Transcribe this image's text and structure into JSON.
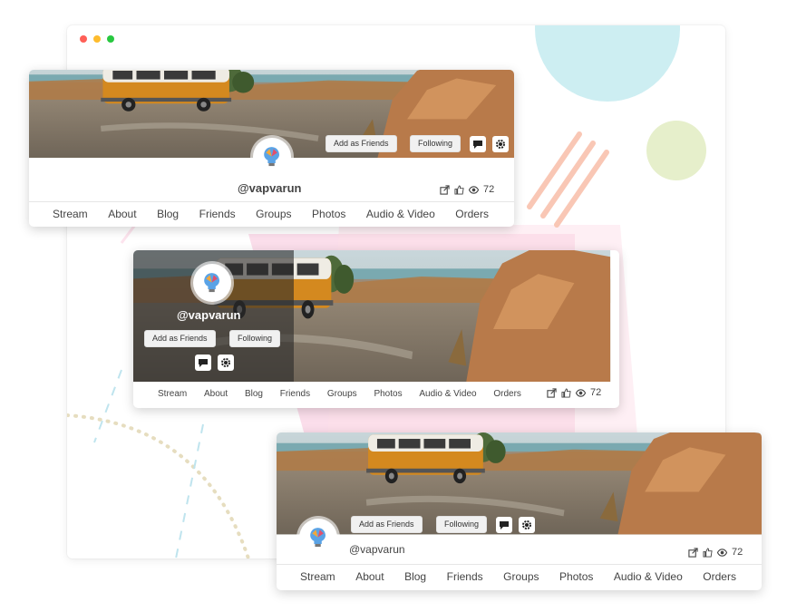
{
  "window": {
    "controls": [
      "close",
      "minimize",
      "maximize"
    ]
  },
  "profile": {
    "handle": "@vapvarun",
    "views": "72",
    "buttons": {
      "add_friend": "Add as Friends",
      "following": "Following"
    },
    "icons": [
      "share-icon",
      "like-icon",
      "eye-icon",
      "message-icon",
      "gear-icon"
    ],
    "tabs": [
      "Stream",
      "About",
      "Blog",
      "Friends",
      "Groups",
      "Photos",
      "Audio & Video",
      "Orders"
    ]
  },
  "colors": {
    "accent_red": "#ff5f57",
    "accent_yellow": "#febc2e",
    "accent_green": "#28c840",
    "deco_blue": "#cdeef2",
    "deco_green": "#e6efcb",
    "deco_pink": "#f8c8dd",
    "overlay_dark": "rgba(40,40,40,0.6)"
  }
}
